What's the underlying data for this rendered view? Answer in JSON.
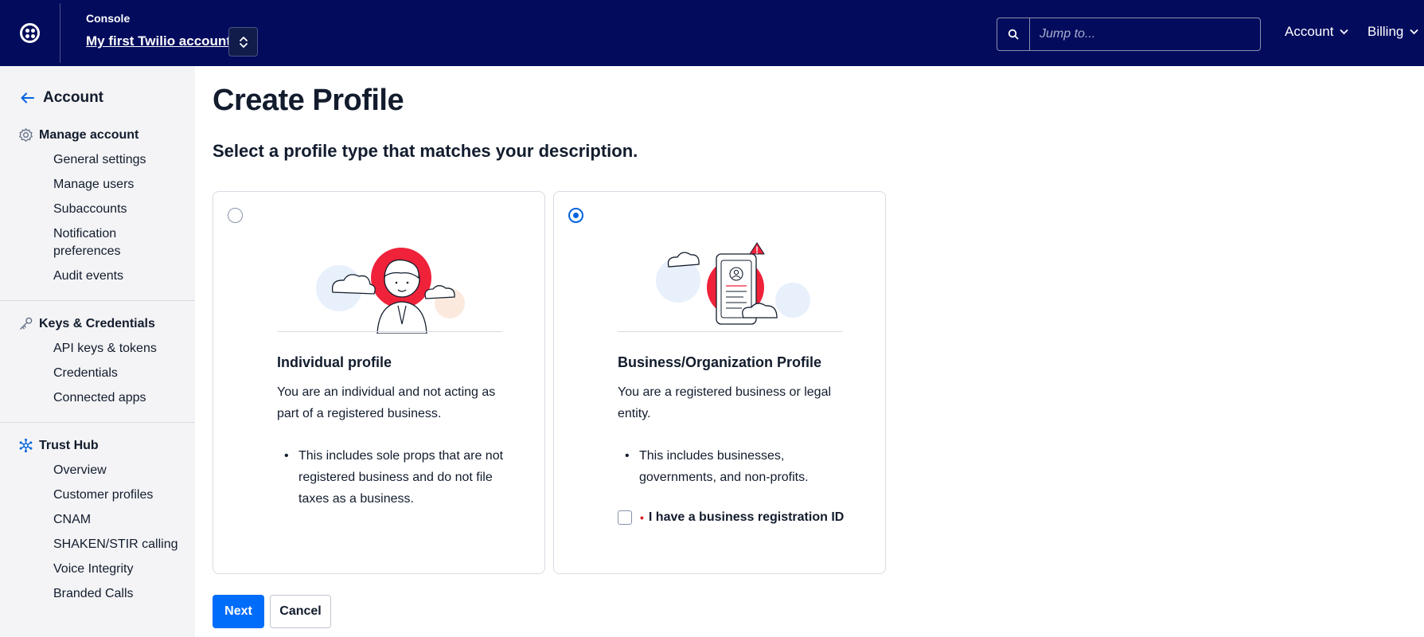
{
  "topbar": {
    "console_label": "Console",
    "account_name": "My first Twilio account",
    "search_placeholder": "Jump to...",
    "menu_account": "Account",
    "menu_billing": "Billing"
  },
  "sidebar": {
    "back_label": "Account",
    "sections": [
      {
        "title": "Manage account",
        "items": [
          "General settings",
          "Manage users",
          "Subaccounts",
          "Notification preferences",
          "Audit events"
        ]
      },
      {
        "title": "Keys & Credentials",
        "items": [
          "API keys & tokens",
          "Credentials",
          "Connected apps"
        ]
      },
      {
        "title": "Trust Hub",
        "items": [
          "Overview",
          "Customer profiles",
          "CNAM",
          "SHAKEN/STIR calling",
          "Voice Integrity",
          "Branded Calls"
        ]
      }
    ]
  },
  "main": {
    "title": "Create Profile",
    "subtitle": "Select a profile type that matches your description.",
    "cards": [
      {
        "selected": false,
        "title": "Individual profile",
        "description": "You are an individual and not acting as part of a registered business.",
        "bullet": "This includes sole props that are not registered business and do not file taxes as a business."
      },
      {
        "selected": true,
        "title": "Business/Organization Profile",
        "description": "You are a registered business or legal entity.",
        "bullet": "This includes businesses, governments, and non-profits.",
        "checkbox_label": "I have a business registration ID",
        "checkbox_checked": false
      }
    ],
    "next_label": "Next",
    "cancel_label": "Cancel"
  },
  "colors": {
    "topbar_bg": "#030b5d",
    "accent_blue": "#006dfa",
    "illustration_red": "#ef223a",
    "sidebar_bg": "#f4f4f6"
  }
}
